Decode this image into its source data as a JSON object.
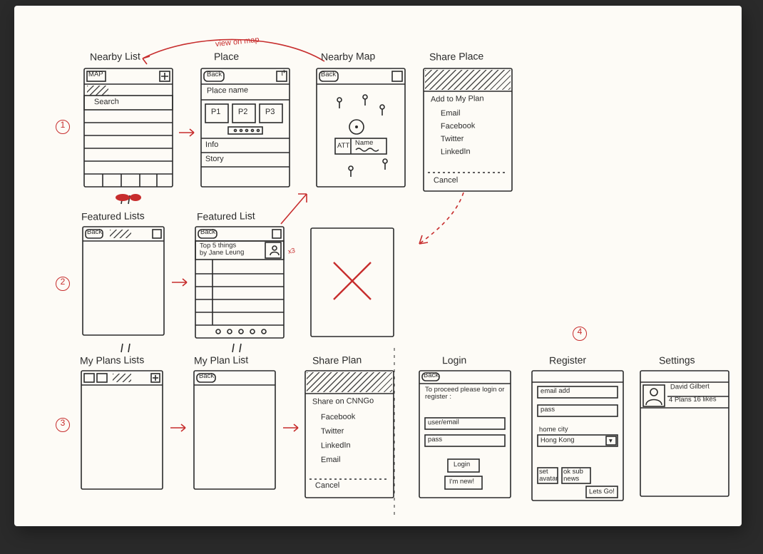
{
  "annotations": {
    "red": {
      "view_on_map": "view on map",
      "step1": "1",
      "step2": "2",
      "step3": "3",
      "removed": "✕",
      "step4": "4",
      "x8": "x3"
    },
    "arrows": {
      "linkA": "row1 nearby→place",
      "linkB": "row2 featured→list",
      "linkC": "row3 plans→list",
      "linkD": "row3 list→share",
      "linkE": "share place ↓ login area",
      "linkF": "featured list ↑ place"
    }
  },
  "screens": {
    "nearby_list": {
      "title": "Nearby List",
      "top_left": "MAP",
      "top_right": "+",
      "search": "Search"
    },
    "place": {
      "title": "Place",
      "back": "Back",
      "action_icon": "↱",
      "name": "Place name",
      "photos": [
        "P1",
        "P2",
        "P3"
      ],
      "info": "Info",
      "story": "Story"
    },
    "nearby_map": {
      "title": "Nearby Map",
      "back": "Back",
      "action_icon": "◻",
      "callout_btn": "ATT",
      "callout_name": "Name"
    },
    "share_place": {
      "title": "Share Place",
      "items": [
        "Add to My Plan",
        "Email",
        "Facebook",
        "Twitter",
        "LinkedIn"
      ],
      "cancel": "Cancel"
    },
    "featured_lists": {
      "title": "Featured Lists",
      "back": "Back"
    },
    "featured_list": {
      "title": "Featured List",
      "back": "Back",
      "action_icon": "↱",
      "list_title": "Top 5 things",
      "list_author": "by Jane Leung",
      "pager_dots": 5
    },
    "my_plans_lists": {
      "title": "My Plans Lists",
      "top_icons": [
        "◻",
        "◻"
      ],
      "top_right": "+"
    },
    "my_plan_list": {
      "title": "My Plan List",
      "back": "Back"
    },
    "share_plan": {
      "title": "Share Plan",
      "heading": "Share on CNNGo",
      "items": [
        "Facebook",
        "Twitter",
        "LinkedIn",
        "Email"
      ],
      "cancel": "Cancel"
    },
    "login": {
      "title": "Login",
      "back": "Back",
      "intro": "To proceed please login or register :",
      "user": "user/email",
      "pass": "pass",
      "login_btn": "Login",
      "new_btn": "I'm new!"
    },
    "register": {
      "title": "Register",
      "email": "email add",
      "pass": "pass",
      "home_city": "home city",
      "home_city_value": "Hong Kong",
      "dropdown_icon": "▾",
      "sub_left": "set avatar",
      "sub_mid": "ok sub news",
      "go_btn": "Lets Go!"
    },
    "settings": {
      "title": "Settings",
      "user_name": "David Gilbert",
      "user_stats": "4 Plans 16 likes"
    }
  }
}
